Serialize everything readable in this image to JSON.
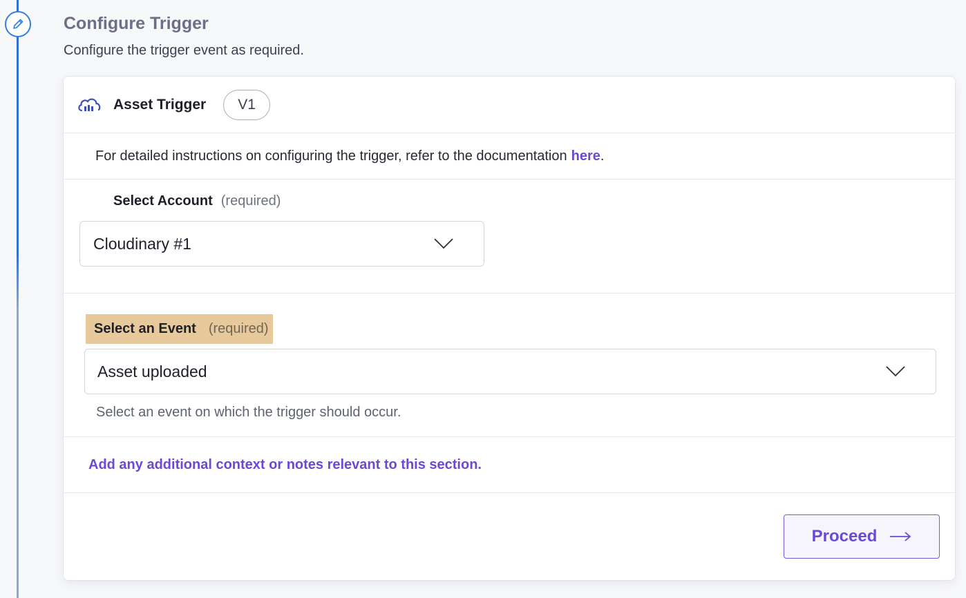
{
  "step": {
    "title": "Configure Trigger",
    "subtitle": "Configure the trigger event as required."
  },
  "card": {
    "title": "Asset Trigger",
    "version": "V1",
    "instructions_text": "For detailed instructions on configuring the trigger, refer to the documentation",
    "instructions_link": "here",
    "instructions_end": "."
  },
  "account": {
    "label": "Select Account",
    "required": "(required)",
    "value": "Cloudinary #1"
  },
  "event": {
    "label": "Select an Event",
    "required": "(required)",
    "value": "Asset uploaded",
    "help": "Select an event on which the trigger should occur."
  },
  "notes": {
    "link": "Add any additional context or notes relevant to this section."
  },
  "actions": {
    "proceed_label": "Proceed"
  },
  "colors": {
    "accent": "#6b48d6",
    "rail": "#2f6fd6",
    "highlight": "#e8c99b"
  },
  "icons": {
    "step": "pencil-icon",
    "app": "cloud-icon",
    "dropdown": "chevron-down-icon",
    "proceed": "arrow-right-icon"
  }
}
